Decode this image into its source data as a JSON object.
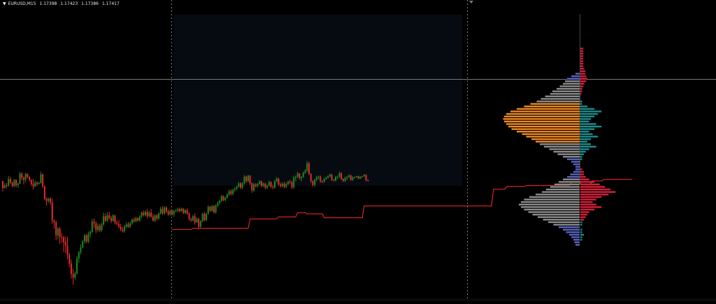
{
  "header": {
    "symbol": "EURUSD,M15",
    "open": "1.17398",
    "high": "1.17423",
    "low": "1.17386",
    "close": "1.17417"
  },
  "colors": {
    "background": "#000000",
    "bull": "#1e8a1e",
    "bear": "#e52b2b",
    "session_box": "#060b12",
    "crosshair": "#7a7a7a",
    "step_line": "#ff2a2a",
    "profile_buy": "#d8203a",
    "profile_sell": "#1b8f8f",
    "profile_gray": "#8c8c8c",
    "profile_orange": "#f08a24",
    "profile_blue": "#5a63c0"
  },
  "chart_data": {
    "type": "candlestick",
    "ohlc": [
      [
        -7,
        -19,
        -34,
        -25
      ],
      [
        -25,
        -13,
        -27,
        -18
      ],
      [
        -18,
        -12,
        -26,
        -20
      ],
      [
        -20,
        6,
        -21,
        -2
      ],
      [
        -2,
        4,
        -15,
        -11
      ],
      [
        -11,
        -9,
        -23,
        -20
      ],
      [
        -20,
        -2,
        -23,
        -5
      ],
      [
        -5,
        -2,
        -23,
        -18
      ],
      [
        -18,
        -11,
        -25,
        -14
      ],
      [
        -14,
        16,
        -15,
        12
      ],
      [
        12,
        15,
        -6,
        1
      ],
      [
        1,
        5,
        -16,
        -4
      ],
      [
        -4,
        14,
        -11,
        11
      ],
      [
        11,
        12,
        0,
        3
      ],
      [
        3,
        5,
        -9,
        -4
      ],
      [
        -4,
        -4,
        -20,
        -15
      ],
      [
        -15,
        -2,
        -29,
        -21
      ],
      [
        -21,
        -6,
        -22,
        -11
      ],
      [
        -11,
        -8,
        -20,
        -15
      ],
      [
        -15,
        -9,
        -16,
        -12
      ],
      [
        -12,
        17,
        -14,
        10
      ],
      [
        10,
        12,
        -24,
        -21
      ],
      [
        -21,
        -19,
        -56,
        -53
      ],
      [
        -53,
        -48,
        -70,
        -58
      ],
      [
        -58,
        -50,
        -63,
        -52
      ],
      [
        -52,
        -49,
        -69,
        -61
      ],
      [
        -61,
        -52,
        -116,
        -108
      ],
      [
        -108,
        -105,
        -129,
        -113
      ],
      [
        -113,
        -109,
        -158,
        -146
      ],
      [
        -146,
        -125,
        -157,
        -129
      ],
      [
        -129,
        -124,
        -168,
        -150
      ],
      [
        -150,
        -140,
        -165,
        -152
      ],
      [
        -152,
        -147,
        -189,
        -163
      ],
      [
        -163,
        -149,
        -191,
        -172
      ],
      [
        -172,
        -150,
        -207,
        -195
      ],
      [
        -195,
        -190,
        -228,
        -218
      ],
      [
        -218,
        -208,
        -256,
        -245
      ],
      [
        -245,
        -231,
        -272,
        -254
      ],
      [
        -254,
        -238,
        -260,
        -243
      ],
      [
        -243,
        -199,
        -246,
        -205
      ],
      [
        -205,
        -186,
        -216,
        -189
      ],
      [
        -189,
        -169,
        -195,
        -177
      ],
      [
        -177,
        -158,
        -179,
        -161
      ],
      [
        -161,
        -143,
        -167,
        -146
      ],
      [
        -146,
        -142,
        -166,
        -162
      ],
      [
        -162,
        -136,
        -166,
        -143
      ],
      [
        -143,
        -133,
        -152,
        -137
      ],
      [
        -137,
        -104,
        -140,
        -111
      ],
      [
        -111,
        -103,
        -127,
        -115
      ],
      [
        -115,
        -110,
        -140,
        -132
      ],
      [
        -132,
        -115,
        -137,
        -122
      ],
      [
        -122,
        -116,
        -138,
        -133
      ],
      [
        -133,
        -113,
        -137,
        -118
      ],
      [
        -118,
        -88,
        -122,
        -97
      ],
      [
        -97,
        -90,
        -112,
        -108
      ],
      [
        -108,
        -87,
        -112,
        -95
      ],
      [
        -95,
        -86,
        -105,
        -102
      ],
      [
        -102,
        -96,
        -115,
        -109
      ],
      [
        -109,
        -92,
        -111,
        -95
      ],
      [
        -95,
        -94,
        -118,
        -114
      ],
      [
        -114,
        -108,
        -120,
        -117
      ],
      [
        -117,
        -107,
        -128,
        -124
      ],
      [
        -124,
        -116,
        -135,
        -131
      ],
      [
        -131,
        -124,
        -139,
        -135
      ],
      [
        -135,
        -119,
        -139,
        -124
      ],
      [
        -124,
        -113,
        -128,
        -118
      ],
      [
        -118,
        -112,
        -127,
        -124
      ],
      [
        -124,
        -111,
        -127,
        -115
      ],
      [
        -115,
        -103,
        -119,
        -106
      ],
      [
        -106,
        -100,
        -114,
        -110
      ],
      [
        -110,
        -98,
        -113,
        -102
      ],
      [
        -102,
        -100,
        -111,
        -108
      ],
      [
        -108,
        -95,
        -111,
        -98
      ],
      [
        -98,
        -85,
        -103,
        -88
      ],
      [
        -88,
        -83,
        -98,
        -94
      ],
      [
        -94,
        -82,
        -98,
        -86
      ],
      [
        -86,
        -79,
        -103,
        -97
      ],
      [
        -97,
        -83,
        -100,
        -88
      ],
      [
        -88,
        -79,
        -101,
        -98
      ],
      [
        -98,
        -91,
        -111,
        -108
      ],
      [
        -108,
        -93,
        -112,
        -95
      ],
      [
        -95,
        -92,
        -108,
        -103
      ],
      [
        -103,
        -87,
        -106,
        -90
      ],
      [
        -90,
        -73,
        -93,
        -78
      ],
      [
        -78,
        -71,
        -94,
        -90
      ],
      [
        -90,
        -71,
        -93,
        -75
      ],
      [
        -75,
        -72,
        -89,
        -85
      ],
      [
        -85,
        -80,
        -96,
        -92
      ],
      [
        -92,
        -80,
        -96,
        -83
      ],
      [
        -83,
        -80,
        -96,
        -92
      ],
      [
        -92,
        -80,
        -99,
        -84
      ],
      [
        -84,
        -79,
        -87,
        -83
      ],
      [
        -83,
        -75,
        -87,
        -79
      ],
      [
        -79,
        -75,
        -88,
        -84
      ],
      [
        -84,
        -75,
        -86,
        -78
      ],
      [
        -78,
        -76,
        -92,
        -89
      ],
      [
        -89,
        -79,
        -92,
        -82
      ],
      [
        -82,
        -77,
        -94,
        -90
      ],
      [
        -90,
        -87,
        -108,
        -104
      ],
      [
        -104,
        -101,
        -112,
        -108
      ],
      [
        -108,
        -94,
        -110,
        -97
      ],
      [
        -97,
        -90,
        -119,
        -113
      ],
      [
        -113,
        -100,
        -114,
        -104
      ],
      [
        -104,
        -101,
        -128,
        -124
      ],
      [
        -124,
        -107,
        -127,
        -110
      ],
      [
        -110,
        -88,
        -113,
        -91
      ],
      [
        -91,
        -86,
        -110,
        -107
      ],
      [
        -107,
        -88,
        -110,
        -91
      ],
      [
        -91,
        -69,
        -93,
        -73
      ],
      [
        -73,
        -71,
        -86,
        -83
      ],
      [
        -83,
        -68,
        -86,
        -71
      ],
      [
        -71,
        -69,
        -90,
        -87
      ],
      [
        -87,
        -66,
        -91,
        -70
      ],
      [
        -70,
        -59,
        -74,
        -63
      ],
      [
        -63,
        -55,
        -68,
        -58
      ],
      [
        -58,
        -42,
        -61,
        -46
      ],
      [
        -46,
        -44,
        -59,
        -56
      ],
      [
        -56,
        -47,
        -59,
        -50
      ],
      [
        -50,
        -39,
        -52,
        -42
      ],
      [
        -42,
        -29,
        -45,
        -33
      ],
      [
        -33,
        -28,
        -44,
        -40
      ],
      [
        -40,
        -27,
        -44,
        -30
      ],
      [
        -30,
        -23,
        -35,
        -27
      ],
      [
        -27,
        -19,
        -30,
        -22
      ],
      [
        -22,
        -10,
        -24,
        -13
      ],
      [
        -13,
        -10,
        -28,
        -24
      ],
      [
        -24,
        -10,
        -28,
        -13
      ],
      [
        -13,
        8,
        -17,
        4
      ],
      [
        4,
        6,
        -12,
        -7
      ],
      [
        -7,
        9,
        -10,
        6
      ],
      [
        6,
        8,
        -17,
        -13
      ],
      [
        -13,
        -11,
        -37,
        -31
      ],
      [
        -31,
        -12,
        -35,
        -16
      ],
      [
        -16,
        -13,
        -24,
        -20
      ],
      [
        -20,
        -12,
        -24,
        -15
      ],
      [
        -15,
        -5,
        -17,
        -8
      ],
      [
        -8,
        -6,
        -23,
        -19
      ],
      [
        -19,
        -11,
        -23,
        -14
      ],
      [
        -14,
        -11,
        -29,
        -24
      ],
      [
        -24,
        -16,
        -28,
        -19
      ],
      [
        -19,
        -6,
        -21,
        -10
      ],
      [
        -10,
        -8,
        -25,
        -22
      ],
      [
        -22,
        -17,
        -28,
        -24
      ],
      [
        -24,
        -4,
        -26,
        -8
      ],
      [
        -8,
        3,
        -10,
        -1
      ],
      [
        -1,
        1,
        -19,
        -16
      ],
      [
        -16,
        -11,
        -24,
        -20
      ],
      [
        -20,
        -11,
        -24,
        -14
      ],
      [
        -14,
        -9,
        -26,
        -22
      ],
      [
        -22,
        -11,
        -25,
        -15
      ],
      [
        -15,
        -6,
        -18,
        -9
      ],
      [
        -9,
        -4,
        -14,
        -11
      ],
      [
        -11,
        -6,
        -28,
        -23
      ],
      [
        -23,
        6,
        -27,
        1
      ],
      [
        1,
        6,
        -8,
        4
      ],
      [
        4,
        16,
        1,
        12
      ],
      [
        12,
        13,
        -4,
        0
      ],
      [
        0,
        5,
        -8,
        3
      ],
      [
        3,
        17,
        1,
        14
      ],
      [
        14,
        23,
        11,
        19
      ],
      [
        19,
        44,
        16,
        38
      ],
      [
        38,
        42,
        8,
        11
      ],
      [
        11,
        13,
        -12,
        -8
      ],
      [
        -8,
        -5,
        -21,
        -17
      ],
      [
        -17,
        -1,
        -21,
        -4
      ],
      [
        -4,
        6,
        -8,
        2
      ],
      [
        2,
        7,
        -4,
        4
      ],
      [
        4,
        7,
        -12,
        -8
      ],
      [
        -8,
        -5,
        -12,
        -9
      ],
      [
        -9,
        1,
        -12,
        -2
      ],
      [
        -2,
        4,
        -5,
        1
      ],
      [
        1,
        8,
        -1,
        5
      ],
      [
        5,
        12,
        2,
        9
      ],
      [
        9,
        11,
        -7,
        -4
      ],
      [
        -4,
        -2,
        -8,
        -6
      ],
      [
        -6,
        6,
        -8,
        3
      ],
      [
        3,
        7,
        -3,
        4
      ],
      [
        4,
        17,
        1,
        13
      ],
      [
        13,
        15,
        -5,
        -2
      ],
      [
        -2,
        0,
        -10,
        -7
      ],
      [
        -7,
        4,
        -10,
        1
      ],
      [
        1,
        6,
        -5,
        3
      ],
      [
        3,
        10,
        1,
        7
      ],
      [
        7,
        9,
        -7,
        -4
      ],
      [
        -4,
        5,
        -7,
        2
      ],
      [
        2,
        4,
        -1,
        3
      ],
      [
        3,
        6,
        1,
        5
      ],
      [
        5,
        6,
        -2,
        -1
      ],
      [
        -1,
        5,
        -2,
        4
      ],
      [
        4,
        6,
        2,
        5
      ],
      [
        5,
        11,
        3,
        8
      ],
      [
        8,
        10,
        -8,
        -5
      ],
      [
        -5,
        -3,
        -9,
        -7
      ]
    ],
    "step_line": [
      [
        0,
        -131
      ],
      [
        10,
        -131
      ],
      [
        11,
        -128
      ],
      [
        40,
        -128
      ],
      [
        41,
        -104
      ],
      [
        55,
        -104
      ],
      [
        56,
        -99
      ],
      [
        65,
        -99
      ],
      [
        66,
        -88
      ],
      [
        70,
        -88
      ],
      [
        71,
        -91
      ],
      [
        79,
        -91
      ],
      [
        80,
        -101
      ],
      [
        100,
        -101
      ],
      [
        101,
        -71
      ],
      [
        168,
        -71
      ],
      [
        169,
        -28
      ],
      [
        175,
        -28
      ],
      [
        176,
        -21
      ],
      [
        185,
        -21
      ],
      [
        186,
        -19
      ],
      [
        200,
        -19
      ],
      [
        201,
        -18
      ],
      [
        209,
        -18
      ],
      [
        210,
        -10
      ],
      [
        214,
        -10
      ],
      [
        215,
        -15
      ],
      [
        220,
        -15
      ],
      [
        221,
        -7
      ],
      [
        226,
        -7
      ],
      [
        227,
        -3
      ],
      [
        242,
        -3
      ]
    ],
    "volume_profile": [
      [
        12,
        0,
        3,
        0
      ],
      [
        11,
        0,
        3,
        0
      ],
      [
        10,
        0,
        3,
        0
      ],
      [
        9,
        0,
        3,
        0
      ],
      [
        8,
        0,
        3,
        0
      ],
      [
        7,
        0,
        3,
        0
      ],
      [
        6,
        0,
        3,
        0
      ],
      [
        5,
        0,
        3,
        0
      ],
      [
        4,
        0,
        4,
        0
      ],
      [
        3,
        0,
        5,
        0
      ],
      [
        2,
        4,
        5,
        0
      ],
      [
        1,
        8,
        6,
        0
      ],
      [
        0,
        12,
        7,
        0
      ],
      [
        -1,
        14,
        6,
        0
      ],
      [
        -2,
        16,
        4,
        0
      ],
      [
        -3,
        19,
        3,
        0
      ],
      [
        -4,
        22,
        2,
        0
      ],
      [
        -5,
        26,
        2,
        0
      ],
      [
        -6,
        28,
        1,
        0
      ],
      [
        -7,
        33,
        0,
        0
      ],
      [
        -8,
        37,
        0,
        0
      ],
      [
        -9,
        41,
        0,
        1
      ],
      [
        -10,
        47,
        0,
        1
      ],
      [
        -11,
        53,
        0,
        4
      ],
      [
        -12,
        60,
        0,
        8
      ],
      [
        -13,
        66,
        0,
        12
      ],
      [
        -14,
        70,
        0,
        10
      ],
      [
        -15,
        72,
        0,
        8
      ],
      [
        -16,
        73,
        0,
        6
      ],
      [
        -17,
        72,
        0,
        5
      ],
      [
        -18,
        70,
        0,
        9
      ],
      [
        -19,
        68,
        0,
        12
      ],
      [
        -20,
        65,
        0,
        8
      ],
      [
        -21,
        60,
        0,
        5
      ],
      [
        -22,
        55,
        0,
        7
      ],
      [
        -23,
        51,
        0,
        10
      ],
      [
        -24,
        46,
        0,
        6
      ],
      [
        -25,
        42,
        0,
        4
      ],
      [
        -26,
        38,
        0,
        6
      ],
      [
        -27,
        34,
        0,
        9
      ],
      [
        -28,
        29,
        0,
        5
      ],
      [
        -29,
        25,
        0,
        3
      ],
      [
        -30,
        21,
        0,
        2
      ],
      [
        -31,
        16,
        0,
        1
      ],
      [
        -32,
        12,
        0,
        1
      ],
      [
        -33,
        8,
        0,
        0
      ],
      [
        -34,
        6,
        0,
        0
      ],
      [
        -35,
        4,
        0,
        0
      ],
      [
        -36,
        4,
        0,
        1
      ],
      [
        -37,
        6,
        0,
        2
      ],
      [
        -38,
        9,
        0,
        2
      ],
      [
        -39,
        12,
        0,
        3
      ],
      [
        -40,
        16,
        0,
        5
      ],
      [
        -41,
        20,
        0,
        8
      ],
      [
        -42,
        24,
        0,
        11
      ],
      [
        -43,
        28,
        0,
        14
      ],
      [
        -44,
        32,
        0,
        17
      ],
      [
        -45,
        36,
        0,
        20
      ],
      [
        -46,
        42,
        0,
        16
      ],
      [
        -47,
        48,
        0,
        12
      ],
      [
        -48,
        53,
        0,
        9
      ],
      [
        -49,
        56,
        0,
        7
      ],
      [
        -50,
        58,
        0,
        9
      ],
      [
        -51,
        56,
        0,
        12
      ],
      [
        -52,
        53,
        0,
        8
      ],
      [
        -53,
        49,
        0,
        5
      ],
      [
        -54,
        45,
        0,
        4
      ],
      [
        -55,
        40,
        0,
        3
      ],
      [
        -56,
        35,
        0,
        2
      ],
      [
        -57,
        30,
        0,
        1
      ],
      [
        -58,
        25,
        0,
        1
      ],
      [
        -59,
        20,
        0,
        0
      ],
      [
        -60,
        16,
        0,
        1
      ],
      [
        -61,
        13,
        0,
        1
      ],
      [
        -62,
        10,
        0,
        2
      ],
      [
        -63,
        8,
        0,
        1
      ],
      [
        -64,
        6,
        0,
        1
      ],
      [
        -65,
        5,
        0,
        0
      ],
      [
        -66,
        4,
        0,
        0
      ]
    ]
  }
}
